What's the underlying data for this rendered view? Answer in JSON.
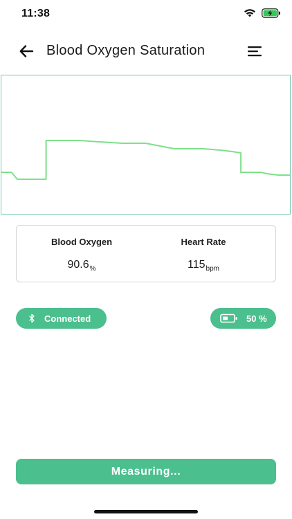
{
  "status_bar": {
    "time": "11:38",
    "battery_icon_color": "#34c759"
  },
  "header": {
    "title": "Blood Oxygen Saturation",
    "back_icon": "arrow-left-icon",
    "menu_icon": "menu-icon"
  },
  "waveform": {
    "line_color": "#7ee08a",
    "border_color": "#6ec9b0",
    "levels": [
      0.7,
      0.7,
      0.75,
      0.75,
      0.75,
      0.75,
      0.47,
      0.47,
      0.47,
      0.48,
      0.49,
      0.49,
      0.53,
      0.53,
      0.54,
      0.55,
      0.56,
      0.7,
      0.7,
      0.71,
      0.72,
      0.72
    ]
  },
  "readings": {
    "blood_oxygen": {
      "label": "Blood Oxygen",
      "value": "90.6",
      "unit": "%"
    },
    "heart_rate": {
      "label": "Heart Rate",
      "value": "115",
      "unit": "bpm"
    }
  },
  "connection": {
    "label": "Connected",
    "icon": "bluetooth-icon"
  },
  "device_battery": {
    "label": "50 %",
    "icon": "battery-icon",
    "level": 0.5
  },
  "action": {
    "label": "Measuring..."
  },
  "colors": {
    "accent": "#4bbf8e",
    "text": "#1b1b1b"
  }
}
